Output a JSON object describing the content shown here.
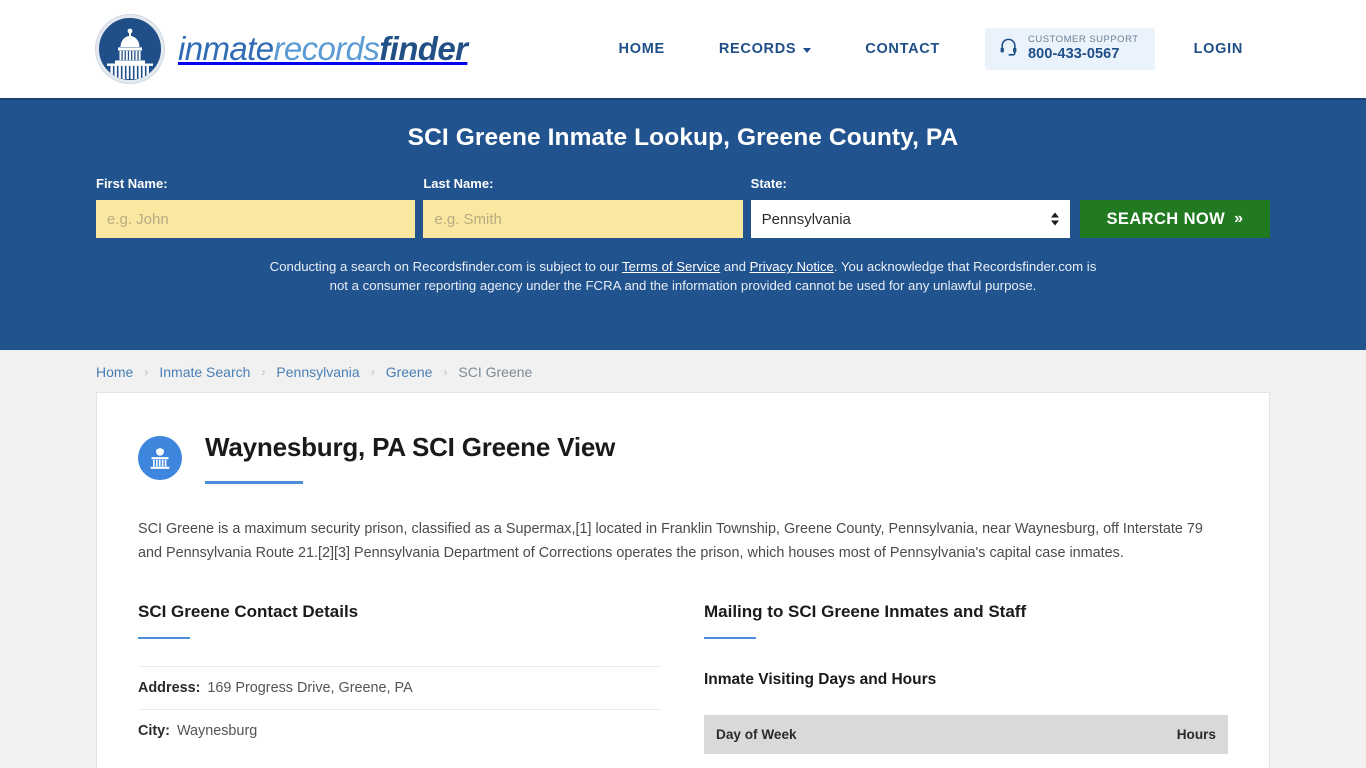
{
  "header": {
    "brand": {
      "part1": "inmate",
      "part2": "records",
      "part3": "finder"
    },
    "logo_icon": "capitol-dome-icon",
    "nav": [
      {
        "label": "HOME",
        "has_caret": false
      },
      {
        "label": "RECORDS",
        "has_caret": true
      },
      {
        "label": "CONTACT",
        "has_caret": false
      }
    ],
    "support": {
      "icon": "headset-icon",
      "label": "CUSTOMER SUPPORT",
      "phone": "800-433-0567"
    },
    "login_label": "LOGIN"
  },
  "hero": {
    "title": "SCI Greene Inmate Lookup, Greene County, PA",
    "background_color": "#21538f",
    "fields": {
      "first_name": {
        "label": "First Name:",
        "value": "",
        "placeholder": "e.g. John"
      },
      "last_name": {
        "label": "Last Name:",
        "value": "",
        "placeholder": "e.g. Smith"
      },
      "state": {
        "label": "State:",
        "selected": "Pennsylvania",
        "options": [
          "Pennsylvania"
        ]
      }
    },
    "search_button": {
      "label": "SEARCH NOW",
      "chevron": "»",
      "color": "#217a21"
    },
    "disclaimer": {
      "part1": "Conducting a search on Recordsfinder.com is subject to our ",
      "link1": "Terms of Service",
      "mid": " and ",
      "link2": "Privacy Notice",
      "part2": ". You acknowledge that Recordsfinder.com is not a consumer reporting agency under the FCRA and the information provided cannot be used for any unlawful purpose."
    }
  },
  "breadcrumb": {
    "items": [
      "Home",
      "Inmate Search",
      "Pennsylvania",
      "Greene",
      "SCI Greene"
    ],
    "separator": "›"
  },
  "main": {
    "icon": "prison-building-icon",
    "title": "Waynesburg, PA SCI Greene View",
    "intro": "SCI Greene is a maximum security prison, classified as a Supermax,[1] located in Franklin Township, Greene County, Pennsylvania, near Waynesburg, off Interstate 79 and Pennsylvania Route 21.[2][3] Pennsylvania Department of Corrections operates the prison, which houses most of Pennsylvania's capital case inmates.",
    "left_column": {
      "title": "SCI Greene Contact Details",
      "details": [
        {
          "label": "Address:",
          "value": "169 Progress Drive, Greene, PA"
        },
        {
          "label": "City:",
          "value": "Waynesburg"
        }
      ]
    },
    "right_column": {
      "title": "Mailing to SCI Greene Inmates and Staff",
      "sub_title": "Inmate Visiting Days and Hours",
      "table": {
        "headers": [
          "Day of Week",
          "Hours"
        ],
        "rows": []
      }
    },
    "accent_color": "#4a8ddb"
  }
}
